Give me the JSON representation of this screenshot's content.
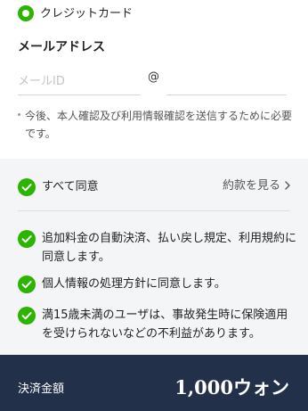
{
  "payment": {
    "method_label": "クレジットカード"
  },
  "email": {
    "title": "メールアドレス",
    "local_placeholder": "メールID",
    "at_symbol": "@",
    "domain_value": ""
  },
  "notice": "今後、本人確認及び利用情報確認を送信するために必要です。",
  "agreement": {
    "agree_all_label": "すべて同意",
    "view_terms_label": "約款を見る",
    "items": [
      {
        "label": "追加料金の自動決済、払い戻し規定、利用規約に同意します。"
      },
      {
        "label": "個人情報の処理方針に同意します。"
      },
      {
        "label": "満15歳未満のユーザは、事故発生時に保険適用を受けられないなどの不利益があります。"
      }
    ]
  },
  "footer": {
    "amount_label": "決済金額",
    "amount_value": "1,000ウォン"
  },
  "colors": {
    "accent": "#2db400",
    "footer_bg": "#23304a",
    "panel_bg": "#f4f5f7"
  }
}
